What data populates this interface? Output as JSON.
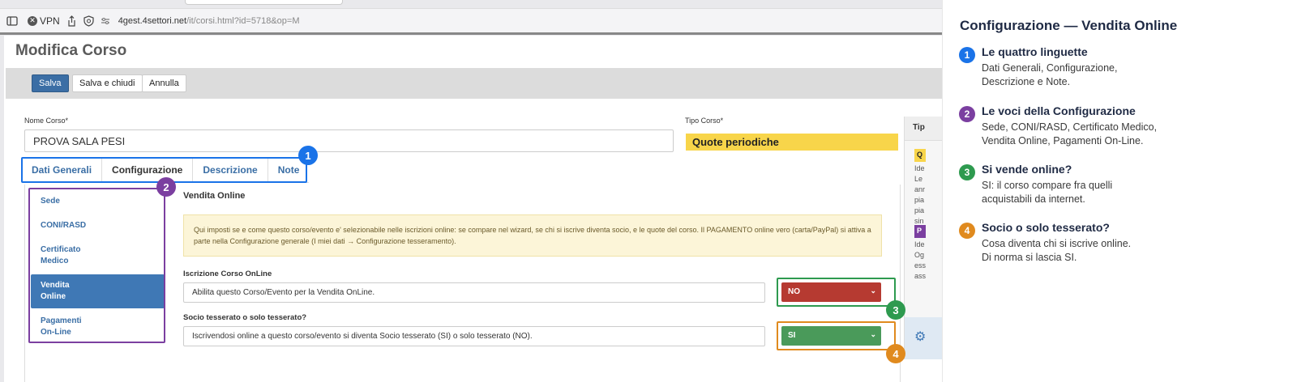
{
  "browser": {
    "vpn_label": "VPN",
    "url_host": "4gest.4settori.net",
    "url_path": "/it/corsi.html?id=5718&op=M"
  },
  "page": {
    "title": "Modifica Corso"
  },
  "toolbar": {
    "save_label": "Salva",
    "save_close_label": "Salva e chiudi",
    "cancel_label": "Annulla"
  },
  "form": {
    "nome_label": "Nome Corso*",
    "nome_value": "PROVA SALA PESI",
    "tipo_label": "Tipo Corso*",
    "tipo_value": "Quote periodiche"
  },
  "tabs": [
    {
      "label": "Dati Generali"
    },
    {
      "label": "Configurazione"
    },
    {
      "label": "Descrizione"
    },
    {
      "label": "Note"
    }
  ],
  "sidenav": [
    {
      "line1": "Sede",
      "line2": ""
    },
    {
      "line1": "CONI/RASD",
      "line2": ""
    },
    {
      "line1": "Certificato",
      "line2": "Medico"
    },
    {
      "line1": "Vendita",
      "line2": "Online"
    },
    {
      "line1": "Pagamenti",
      "line2": "On-Line"
    }
  ],
  "section": {
    "title": "Vendita Online",
    "notice": "Qui imposti se e come questo corso/evento e' selezionabile nelle iscrizioni online: se compare nel wizard, se chi si iscrive diventa socio, e le quote del corso. Il PAGAMENTO online vero (carta/PayPal) si attiva a parte nella Configurazione generale (I miei dati → Configurazione tesseramento).",
    "q1_label": "Iscrizione Corso OnLine",
    "q1_text": "Abilita questo Corso/Evento per la Vendita OnLine.",
    "q1_value": "NO",
    "q2_label": "Socio tesserato o solo tesserato?",
    "q2_text": "Iscrivendosi online a questo corso/evento si diventa Socio tesserato (SI) o solo tesserato (NO).",
    "q2_value": "SI"
  },
  "cut_panel": {
    "header": "Tip",
    "badge1": "Q",
    "lines1": [
      "Ide",
      "Le",
      "anr",
      "pia",
      "pia",
      "sin"
    ],
    "badge2": "P",
    "lines2": [
      "Ide",
      "Og",
      "ess",
      "ass"
    ]
  },
  "annotations": [
    "1",
    "2",
    "3",
    "4"
  ],
  "explain": {
    "title": "Configurazione — Vendita Online",
    "items": [
      {
        "num": "1",
        "head": "Le quattro linguette",
        "body1": "Dati Generali, Configurazione,",
        "body2": "Descrizione e Note."
      },
      {
        "num": "2",
        "head": "Le voci della Configurazione",
        "body1": "Sede, CONI/RASD, Certificato Medico,",
        "body2": "Vendita Online, Pagamenti On-Line."
      },
      {
        "num": "3",
        "head": "Si vende online?",
        "body1": "SI: il corso compare fra quelli",
        "body2": "acquistabili da internet."
      },
      {
        "num": "4",
        "head": "Socio o solo tesserato?",
        "body1": "Cosa diventa chi si iscrive online.",
        "body2": "Di norma si lascia SI."
      }
    ]
  },
  "colors": {
    "blue": "#1a73e8",
    "purple": "#7b3fa0",
    "green": "#2e9a4f",
    "orange": "#e08a1e"
  }
}
